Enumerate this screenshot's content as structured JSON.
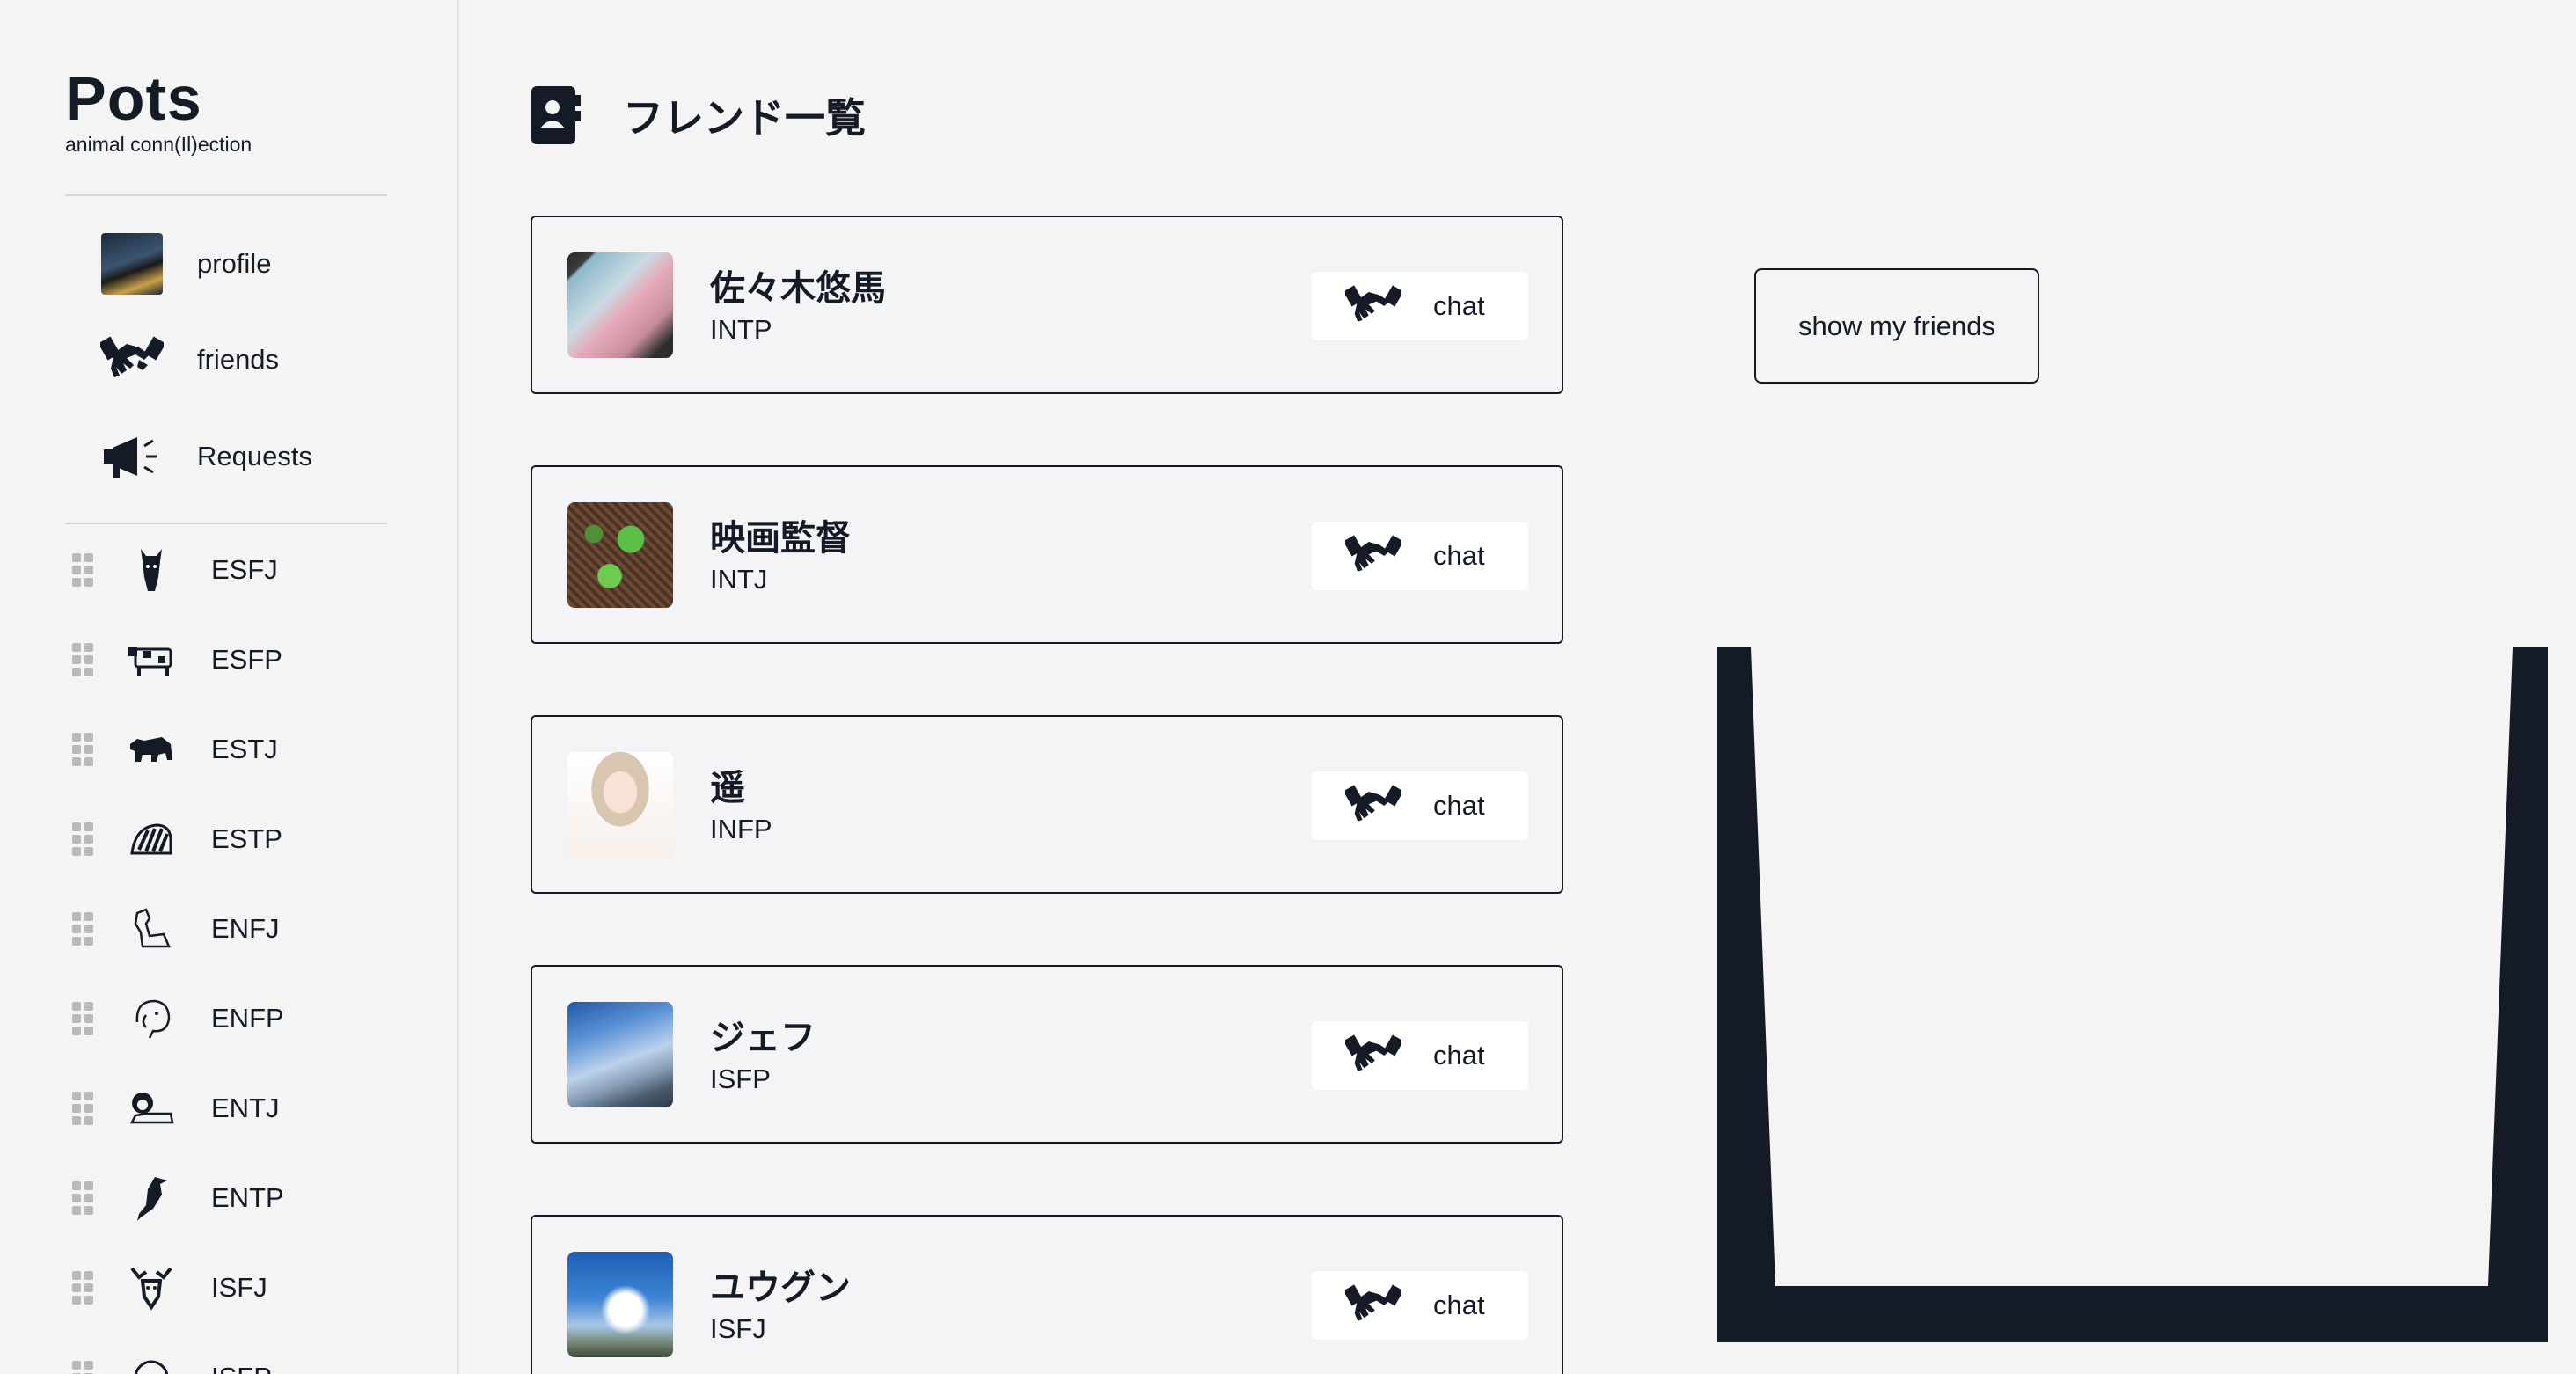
{
  "brand": {
    "title": "Pots",
    "subtitle": "animal conn(Il)ection"
  },
  "nav": [
    {
      "label": "profile",
      "icon": "profile-photo"
    },
    {
      "label": "friends",
      "icon": "handshake-icon"
    },
    {
      "label": "Requests",
      "icon": "megaphone-icon"
    }
  ],
  "animals": [
    {
      "label": "ESFJ",
      "icon": "horse-icon"
    },
    {
      "label": "ESFP",
      "icon": "cow-icon"
    },
    {
      "label": "ESTJ",
      "icon": "bear-icon"
    },
    {
      "label": "ESTP",
      "icon": "zebra-icon"
    },
    {
      "label": "ENFJ",
      "icon": "dog-icon"
    },
    {
      "label": "ENFP",
      "icon": "elephant-icon"
    },
    {
      "label": "ENTJ",
      "icon": "lion-icon"
    },
    {
      "label": "ENTP",
      "icon": "bird-icon"
    },
    {
      "label": "ISFJ",
      "icon": "deer-icon"
    },
    {
      "label": "ISFP",
      "icon": "sheep-icon"
    }
  ],
  "page": {
    "title": "フレンド一覧",
    "icon": "contact-book-icon"
  },
  "friends": [
    {
      "name": "佐々木悠馬",
      "type": "INTP",
      "chat_label": "chat",
      "photo": "cherry-blossom"
    },
    {
      "name": "映画監督",
      "type": "INTJ",
      "chat_label": "chat",
      "photo": "leaves"
    },
    {
      "name": "遥",
      "type": "INFP",
      "chat_label": "chat",
      "photo": "anime-girl"
    },
    {
      "name": "ジェフ",
      "type": "ISFP",
      "chat_label": "chat",
      "photo": "building-sky"
    },
    {
      "name": "ユウグン",
      "type": "ISFJ",
      "chat_label": "chat",
      "photo": "clouds-sky"
    }
  ],
  "show_friends_label": "show my friends",
  "colors": {
    "dark": "#141a26",
    "background": "#f4f4f4",
    "card": "#f4f4f6",
    "chat_button": "#ffffff"
  }
}
